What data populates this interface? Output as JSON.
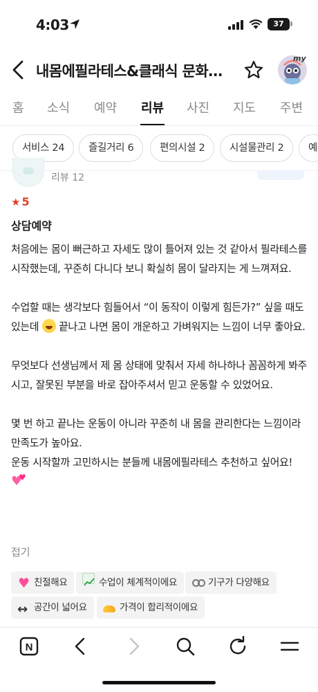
{
  "status_bar": {
    "time": "4:03",
    "battery": "37"
  },
  "header": {
    "title": "내몸에필라테스&클래식 문화…",
    "avatar_tag": "my"
  },
  "tabs": [
    {
      "label": "홈",
      "active": false
    },
    {
      "label": "소식",
      "active": false
    },
    {
      "label": "예약",
      "active": false
    },
    {
      "label": "리뷰",
      "active": true
    },
    {
      "label": "사진",
      "active": false
    },
    {
      "label": "지도",
      "active": false
    },
    {
      "label": "주변",
      "active": false
    }
  ],
  "filter_chips": [
    {
      "label": "서비스 24"
    },
    {
      "label": "즐길거리 6"
    },
    {
      "label": "편의시설 2"
    },
    {
      "label": "시설물관리 2"
    },
    {
      "label": "예"
    }
  ],
  "review": {
    "reviewer_review_count": "리뷰 12",
    "rating_star": "★",
    "rating": "5",
    "visit_type": "상담예약",
    "paragraphs": [
      "처음에는 몸이 뻐근하고 자세도 많이 틀어져 있는 것 같아서 필라테스를 시작했는데, 꾸준히 다니다 보니 확실히 몸이 달라지는 게 느껴져요.",
      "수업할 때는 생각보다 힘들어서 “이 동작이 이렇게 힘든가?” 싶을 때도 있는데",
      "끝나고 나면 몸이 개운하고 가벼워지는 느낌이 너무 좋아요.",
      "무엇보다 선생님께서 제 몸 상태에 맞춰서 자세 하나하나 꼼꼼하게 봐주시고, 잘못된 부분을 바로 잡아주셔서 믿고 운동할 수 있었어요.",
      "몇 번 하고 끝나는 운동이 아니라 꾸준히 내 몸을 관리한다는 느낌이라 만족도가 높아요.",
      "운동 시작할까 고민하시는 분들께 내몸에필라테스 추천하고 싶어요!"
    ],
    "fold_label": "접기",
    "keywords": [
      {
        "label": "친절해요",
        "icon": "heart-icon"
      },
      {
        "label": "수업이 체계적이에요",
        "icon": "chart-icon"
      },
      {
        "label": "기구가 다양해요",
        "icon": "goggles-icon"
      },
      {
        "label": "공간이 넓어요",
        "icon": "arrows-icon"
      },
      {
        "label": "가격이 합리적이에요",
        "icon": "money-icon"
      }
    ]
  },
  "toolbar": {
    "home_label": "N"
  }
}
